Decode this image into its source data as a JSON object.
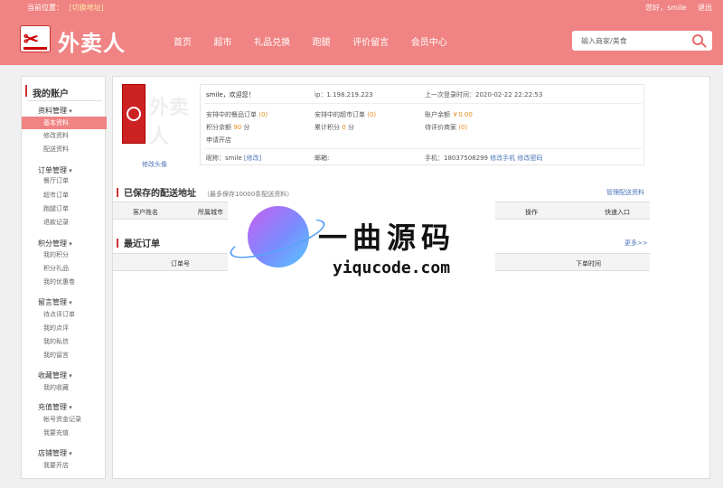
{
  "topbar": {
    "location_label": "当前位置：",
    "switch_label": "[切换地址]",
    "greeting": "您好，smile",
    "logout": "退出"
  },
  "header": {
    "brand": "外卖人",
    "nav": [
      "首页",
      "超市",
      "礼品兑换",
      "跑腿",
      "评价留言",
      "会员中心"
    ],
    "search_placeholder": "输入商家/美食"
  },
  "sidebar": {
    "title": "我的账户",
    "groups": [
      {
        "label": "资料管理",
        "items": [
          "基本资料",
          "修改资料",
          "配送资料"
        ]
      },
      {
        "label": "订单管理",
        "items": [
          "餐厅订单",
          "超市订单",
          "跑腿订单",
          "退款记录"
        ]
      },
      {
        "label": "积分管理",
        "items": [
          "我的积分",
          "积分礼品",
          "我的优惠卷"
        ]
      },
      {
        "label": "留言管理",
        "items": [
          "待点评订单",
          "我的点评",
          "我的私信",
          "我的留言"
        ]
      },
      {
        "label": "收藏管理",
        "items": [
          "我的收藏"
        ]
      },
      {
        "label": "充值管理",
        "items": [
          "帐号资金记录",
          "我要充值"
        ]
      },
      {
        "label": "店铺管理",
        "items": [
          "我要开店"
        ]
      }
    ]
  },
  "profile": {
    "avatar_text": "外卖人",
    "change_avatar": "修改头像",
    "welcome": "smile，欢迎您！",
    "ip": "ip：1.198.219.223",
    "last_login": "上一次登录时间：2020-02-22 22:22:53",
    "food_orders_label": "安排中的餐品订单",
    "food_orders_count": "(0)",
    "market_orders_label": "安排中的超市订单",
    "market_orders_count": "(0)",
    "balance_label": "账户余额",
    "balance_value": "￥0.00",
    "points_label": "积分余额",
    "points_value": "90",
    "points_unit": "分",
    "total_points_label": "累计积分",
    "total_points_value": "0",
    "total_points_unit": "分",
    "pending_review_label": "待评价商家",
    "pending_review_count": "(0)",
    "apply_shop": "申请开店",
    "nickname_label": "昵称：smile",
    "nickname_edit": "[修改]",
    "email_label": "邮箱:",
    "phone_label": "手机：18037508299",
    "change_phone": "修改手机",
    "change_password": "修改密码"
  },
  "addresses": {
    "title": "已保存的配送地址",
    "hint": "（最多保存10000条配送资料）",
    "manage_link": "管理配送资料",
    "columns": [
      "客户姓名",
      "所属城市",
      "操作",
      "快速入口"
    ]
  },
  "orders": {
    "title": "最近订单",
    "more_link": "更多>>",
    "columns": [
      "订单号",
      "下单时间"
    ]
  },
  "watermark": {
    "cn": "一曲源码",
    "en": "yiqucode.com"
  }
}
